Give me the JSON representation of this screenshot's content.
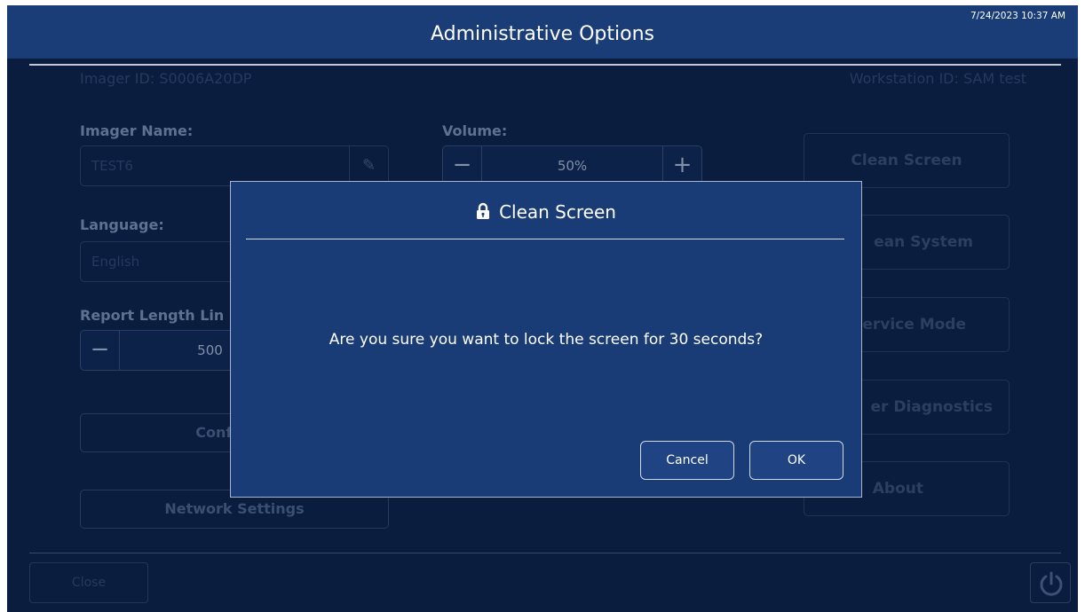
{
  "header": {
    "title": "Administrative Options",
    "timestamp": "7/24/2023 10:37 AM"
  },
  "info": {
    "imager_id": "Imager ID: S0006A20DP",
    "workstation_id": "Workstation ID: SAM test"
  },
  "imager_name": {
    "label": "Imager Name:",
    "value": "TEST6"
  },
  "volume": {
    "label": "Volume:",
    "value": "50%",
    "minus": "−",
    "plus": "+"
  },
  "language": {
    "label": "Language:",
    "value": "English"
  },
  "report_length": {
    "label": "Report Length Lin",
    "value": "500",
    "minus": "−"
  },
  "left_buttons": {
    "configure": "Configure",
    "network_settings": "Network Settings"
  },
  "right_buttons": {
    "clean_screen": "Clean Screen",
    "clean_system": "ean System",
    "service_mode": "ervice Mode",
    "diagnostics": "er Diagnostics",
    "about": "About"
  },
  "footer": {
    "close": "Close"
  },
  "modal": {
    "title": "Clean Screen",
    "message": "Are you sure you want to lock the screen for 30 seconds?",
    "cancel": "Cancel",
    "ok": "OK"
  },
  "icons": {
    "lock": "lock-icon",
    "pencil": "pencil-icon",
    "power": "power-icon"
  },
  "colors": {
    "background": "#0b1d3f",
    "header": "#1a3d78",
    "modal": "#1a3c76",
    "text": "#ffffff"
  }
}
